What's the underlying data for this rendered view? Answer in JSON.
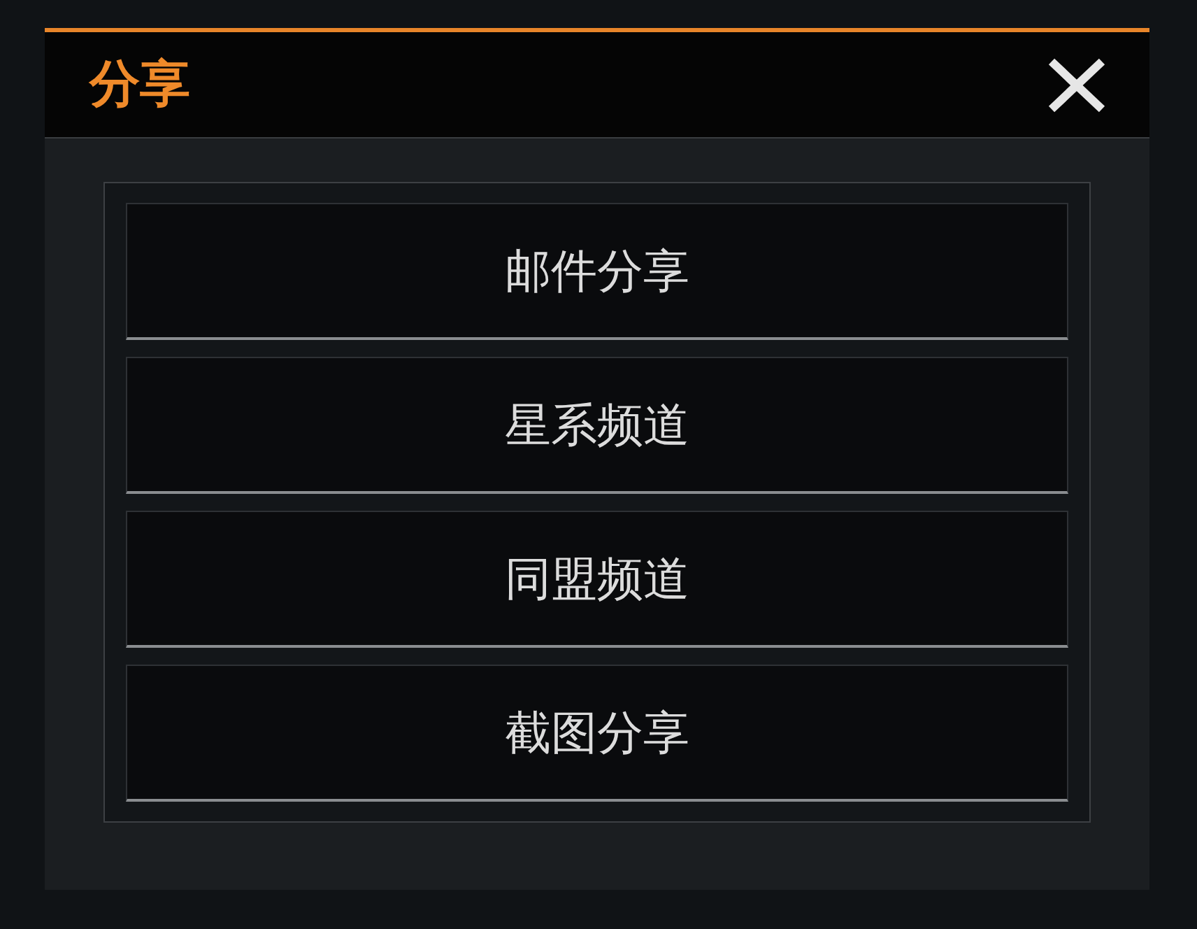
{
  "dialog": {
    "title": "分享"
  },
  "options": [
    {
      "label": "邮件分享"
    },
    {
      "label": "星系频道"
    },
    {
      "label": "同盟频道"
    },
    {
      "label": "截图分享"
    }
  ]
}
